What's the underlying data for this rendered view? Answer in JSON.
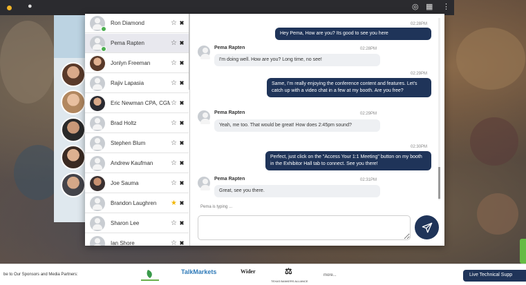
{
  "colors": {
    "navy": "#1f3459",
    "online": "#4caf50",
    "favorite": "#f2b705",
    "livetab": "#66bb44"
  },
  "users": [
    {
      "name": "Ron Diamond",
      "favorite": false,
      "online": true,
      "avatar": "generic"
    },
    {
      "name": "Pema Rapten",
      "favorite": false,
      "online": true,
      "avatar": "generic",
      "selected": true
    },
    {
      "name": "Jonlyn Freeman",
      "favorite": false,
      "online": false,
      "avatar": "photo"
    },
    {
      "name": "Rajiv Lapasia",
      "favorite": false,
      "online": false,
      "avatar": "generic"
    },
    {
      "name": "Eric Newman CPA, CGMA",
      "favorite": false,
      "online": false,
      "avatar": "photo"
    },
    {
      "name": "Brad Holtz",
      "favorite": false,
      "online": false,
      "avatar": "generic"
    },
    {
      "name": "Stephen Blum",
      "favorite": false,
      "online": false,
      "avatar": "generic"
    },
    {
      "name": "Andrew Kaufman",
      "favorite": false,
      "online": false,
      "avatar": "generic"
    },
    {
      "name": "Joe Sauma",
      "favorite": false,
      "online": false,
      "avatar": "photo"
    },
    {
      "name": "Brandon Laughren",
      "favorite": true,
      "online": false,
      "avatar": "generic"
    },
    {
      "name": "Sharon Lee",
      "favorite": false,
      "online": false,
      "avatar": "generic"
    },
    {
      "name": "Ian Shore",
      "favorite": false,
      "online": false,
      "avatar": "generic"
    }
  ],
  "messages": [
    {
      "dir": "out",
      "time": "02:28PM",
      "text": "Hey Pema, How are you? Its good to see you here"
    },
    {
      "dir": "in",
      "sender": "Pema Rapten",
      "time": "02:28PM",
      "text": "I'm doing well. How are you? Long time, no see!"
    },
    {
      "dir": "out",
      "time": "02:29PM",
      "text": "Same, I'm really enjoying the conference content and features. Let's catch up with a video chat in a few at my booth. Are you free?"
    },
    {
      "dir": "in",
      "sender": "Pema Rapten",
      "time": "02:29PM",
      "text": "Yeah, me too. That would be great! How does 2:45pm sound?"
    },
    {
      "dir": "out",
      "time": "02:30PM",
      "text": "Perfect, just click on the \"Access Your 1:1 Meeting\" button on my booth in the Exhibitor Hall tab to connect. See you there!"
    },
    {
      "dir": "in",
      "sender": "Pema Rapten",
      "time": "02:31PM",
      "text": "Great, see you there."
    }
  ],
  "typing_indicator": "Pema is typing ...",
  "composer": {
    "placeholder": "",
    "send_icon": "paper-plane-icon"
  },
  "sponsor_bar": {
    "text": "be to Our Sponsors and Media Partners:",
    "logos": [
      "TalkMarkets",
      "Wider",
      "TEXAS BANKERS ALLIANCE"
    ],
    "more": "more...",
    "live_button": "Live Technical Supp"
  }
}
